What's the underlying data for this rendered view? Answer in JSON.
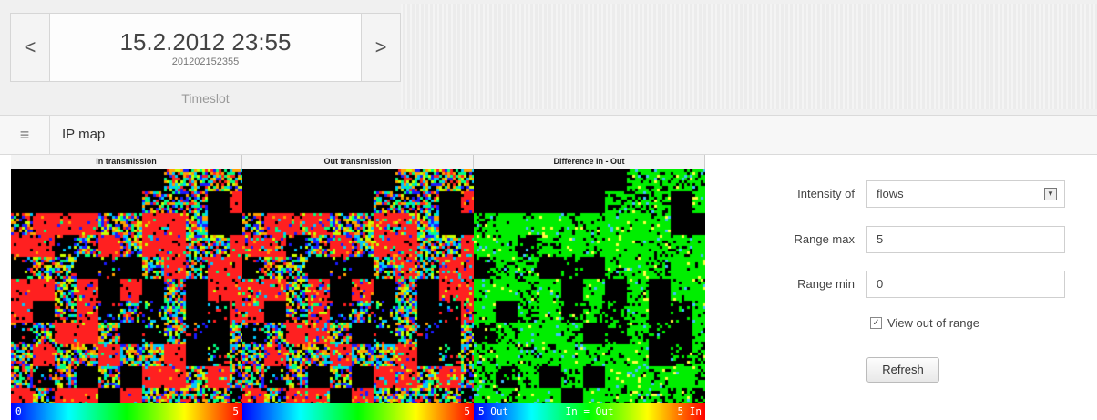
{
  "timeslot": {
    "prev_label": "<",
    "next_label": ">",
    "datetime": "15.2.2012 23:55",
    "code": "201202152355",
    "label": "Timeslot"
  },
  "ipmap": {
    "menu_icon": "hamburger-menu-icon",
    "title": "IP map",
    "panels": [
      {
        "title": "In transmission",
        "scale_min": "0",
        "scale_max": "5",
        "scale_mid": ""
      },
      {
        "title": "Out transmission",
        "scale_min": "",
        "scale_max": "5",
        "scale_mid": ""
      },
      {
        "title": "Difference In - Out",
        "scale_min": "5 Out",
        "scale_max": "5 In",
        "scale_mid": "In = Out"
      }
    ]
  },
  "controls": {
    "intensity_label": "Intensity of",
    "intensity_value": "flows",
    "range_max_label": "Range max",
    "range_max_value": "5",
    "range_min_label": "Range min",
    "range_min_value": "0",
    "view_out_of_range_label": "View out of range",
    "view_out_of_range_checked": true,
    "refresh_label": "Refresh"
  },
  "colors": {
    "rainbow_scale": [
      "#0000ff",
      "#00ffff",
      "#00ff00",
      "#ffff00",
      "#ff0000"
    ],
    "difference_scale": [
      "#0000ff",
      "#00ffff",
      "#00ff00",
      "#ffff00",
      "#ff0000"
    ]
  }
}
